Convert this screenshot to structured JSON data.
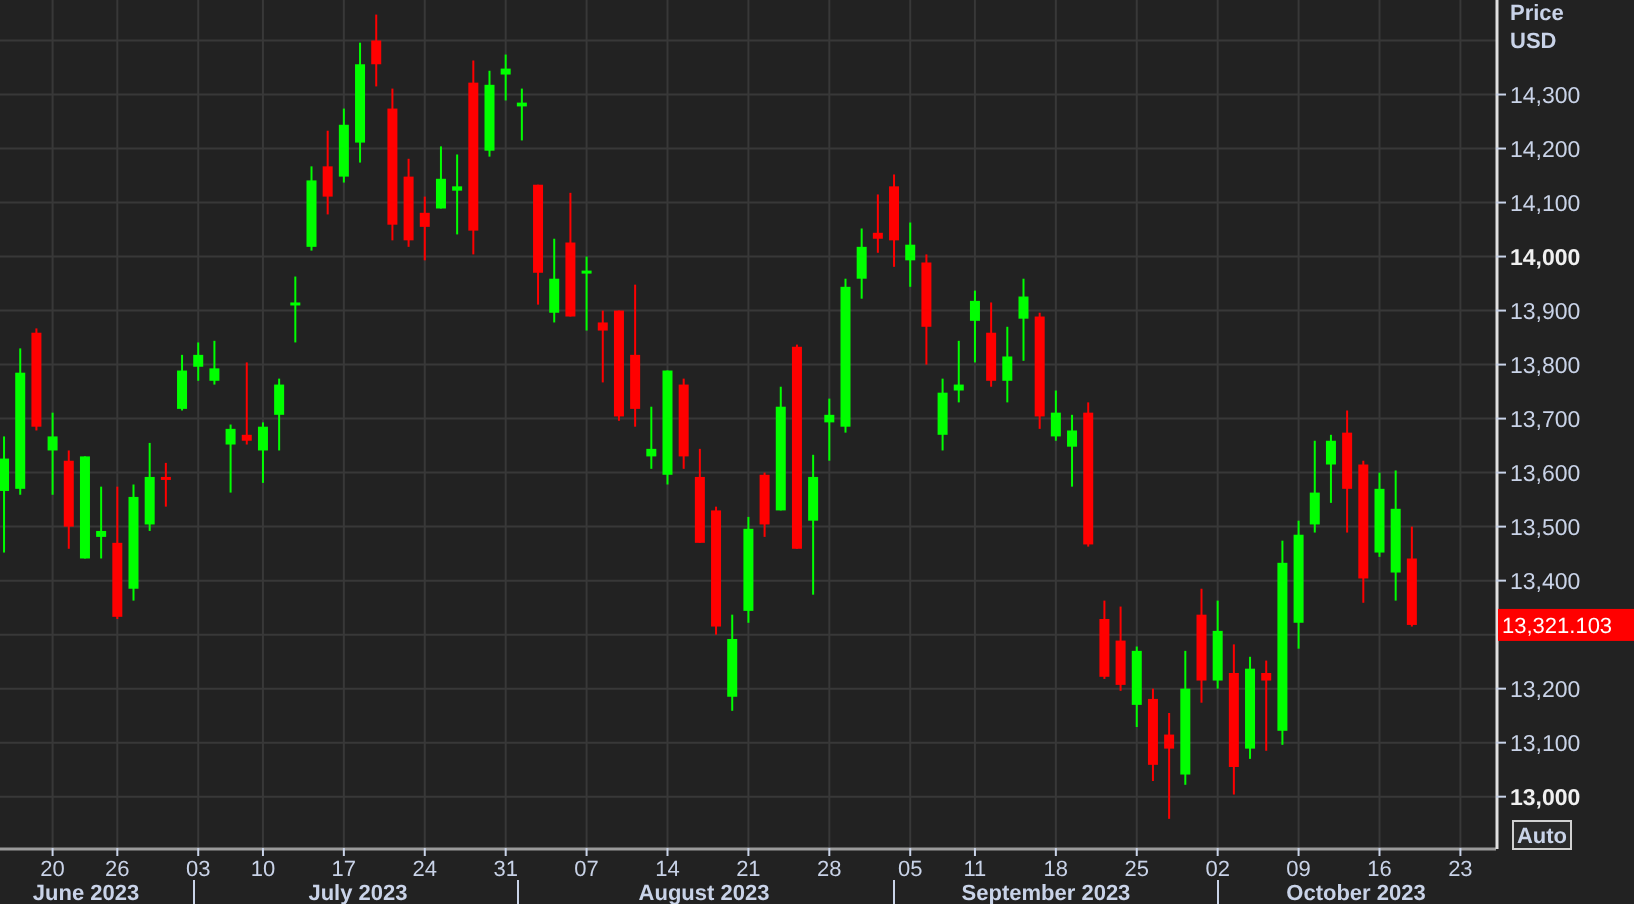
{
  "chart": {
    "axis_unit": "USD",
    "last_price": "13,321.103",
    "auto_button": "Auto",
    "month_labels": [
      "June 2023",
      "July 2023",
      "August 2023",
      "September 2023",
      "October 2023"
    ],
    "chart_data": {
      "type": "candlestick",
      "ylabel": "Price",
      "ylim": [
        12905,
        14475
      ],
      "grid": true,
      "yticks": [
        {
          "value": 13000,
          "label": "13,000"
        },
        {
          "value": 13100,
          "label": "13,100"
        },
        {
          "value": 13200,
          "label": "13,200"
        },
        {
          "value": 13400,
          "label": "13,400"
        },
        {
          "value": 13500,
          "label": "13,500"
        },
        {
          "value": 13600,
          "label": "13,600"
        },
        {
          "value": 13700,
          "label": "13,700"
        },
        {
          "value": 13800,
          "label": "13,800"
        },
        {
          "value": 13900,
          "label": "13,900"
        },
        {
          "value": 14000,
          "label": "14,000"
        },
        {
          "value": 14100,
          "label": "14,100"
        },
        {
          "value": 14200,
          "label": "14,200"
        },
        {
          "value": 14300,
          "label": "14,300"
        }
      ],
      "categories": [
        null,
        null,
        null,
        "20",
        null,
        null,
        null,
        "26",
        null,
        null,
        null,
        null,
        "03",
        null,
        null,
        null,
        "10",
        null,
        null,
        null,
        null,
        "17",
        null,
        null,
        null,
        null,
        "24",
        null,
        null,
        null,
        null,
        "31",
        null,
        null,
        null,
        null,
        "07",
        null,
        null,
        null,
        null,
        "14",
        null,
        null,
        null,
        null,
        "21",
        null,
        null,
        null,
        null,
        "28",
        null,
        null,
        null,
        null,
        "05",
        null,
        null,
        null,
        "11",
        null,
        null,
        null,
        null,
        "18",
        null,
        null,
        null,
        null,
        "25",
        null,
        null,
        null,
        null,
        "02",
        null,
        null,
        null,
        null,
        "09",
        null,
        null,
        null,
        null,
        "16",
        null,
        null,
        null,
        null,
        "23"
      ],
      "ohlc": [
        [
          13566,
          13667,
          13452,
          13626
        ],
        [
          13570,
          13830,
          13559,
          13785
        ],
        [
          13859,
          13867,
          13678,
          13685
        ],
        [
          13641,
          13711,
          13559,
          13667
        ],
        [
          13622,
          13641,
          13459,
          13500
        ],
        [
          13441,
          13630,
          13441,
          13630
        ],
        [
          13481,
          13574,
          13441,
          13492
        ],
        [
          13470,
          13574,
          13329,
          13333
        ],
        [
          13385,
          13578,
          13363,
          13555
        ],
        [
          13504,
          13655,
          13492,
          13592
        ],
        [
          13592,
          13618,
          13537,
          13589
        ],
        [
          13718,
          13818,
          13715,
          13789
        ],
        [
          13796,
          13841,
          13770,
          13818
        ],
        [
          13770,
          13844,
          13763,
          13793
        ],
        [
          13652,
          13689,
          13563,
          13681
        ],
        [
          13670,
          13804,
          13652,
          13659
        ],
        [
          13641,
          13693,
          13581,
          13685
        ],
        [
          13707,
          13774,
          13641,
          13763
        ],
        [
          13911,
          13963,
          13841,
          13915
        ],
        [
          14018,
          14167,
          14011,
          14141
        ],
        [
          14167,
          14233,
          14078,
          14111
        ],
        [
          14148,
          14274,
          14137,
          14244
        ],
        [
          14211,
          14396,
          14174,
          14356
        ],
        [
          14400,
          14448,
          14315,
          14356
        ],
        [
          14274,
          14311,
          14030,
          14059
        ],
        [
          14148,
          14181,
          14018,
          14030
        ],
        [
          14081,
          14111,
          13993,
          14055
        ],
        [
          14089,
          14204,
          14089,
          14144
        ],
        [
          14122,
          14189,
          14041,
          14130
        ],
        [
          14322,
          14363,
          14004,
          14048
        ],
        [
          14196,
          14344,
          14185,
          14318
        ],
        [
          14337,
          14374,
          14289,
          14348
        ],
        [
          14278,
          14311,
          14215,
          14285
        ],
        [
          14133,
          14133,
          13911,
          13970
        ],
        [
          13896,
          14033,
          13878,
          13959
        ],
        [
          14026,
          14118,
          13889,
          13889
        ],
        [
          13974,
          14000,
          13863,
          13974
        ],
        [
          13878,
          13900,
          13767,
          13863
        ],
        [
          13900,
          13900,
          13696,
          13704
        ],
        [
          13818,
          13948,
          13685,
          13718
        ],
        [
          13630,
          13722,
          13607,
          13644
        ],
        [
          13596,
          13789,
          13578,
          13789
        ],
        [
          13763,
          13774,
          13607,
          13630
        ],
        [
          13592,
          13644,
          13470,
          13470
        ],
        [
          13530,
          13537,
          13300,
          13315
        ],
        [
          13185,
          13337,
          13159,
          13292
        ],
        [
          13344,
          13518,
          13322,
          13496
        ],
        [
          13596,
          13600,
          13481,
          13504
        ],
        [
          13530,
          13759,
          13530,
          13722
        ],
        [
          13833,
          13837,
          13459,
          13459
        ],
        [
          13511,
          13633,
          13374,
          13592
        ],
        [
          13693,
          13737,
          13622,
          13707
        ],
        [
          13685,
          13959,
          13674,
          13944
        ],
        [
          13959,
          14052,
          13922,
          14018
        ],
        [
          14044,
          14115,
          14007,
          14033
        ],
        [
          14130,
          14152,
          13981,
          14030
        ],
        [
          13993,
          14063,
          13944,
          14022
        ],
        [
          13989,
          14004,
          13800,
          13870
        ],
        [
          13670,
          13774,
          13641,
          13748
        ],
        [
          13752,
          13844,
          13730,
          13763
        ],
        [
          13881,
          13937,
          13804,
          13918
        ],
        [
          13859,
          13915,
          13759,
          13770
        ],
        [
          13770,
          13870,
          13730,
          13815
        ],
        [
          13885,
          13959,
          13807,
          13926
        ],
        [
          13889,
          13896,
          13681,
          13704
        ],
        [
          13667,
          13752,
          13659,
          13711
        ],
        [
          13648,
          13707,
          13574,
          13678
        ],
        [
          13711,
          13730,
          13463,
          13467
        ],
        [
          13329,
          13363,
          13218,
          13222
        ],
        [
          13289,
          13352,
          13196,
          13207
        ],
        [
          13170,
          13278,
          13129,
          13270
        ],
        [
          13181,
          13200,
          13029,
          13059
        ],
        [
          13115,
          13155,
          12959,
          13089
        ],
        [
          13041,
          13270,
          13022,
          13200
        ],
        [
          13337,
          13385,
          13174,
          13215
        ],
        [
          13215,
          13363,
          13200,
          13307
        ],
        [
          13229,
          13282,
          13004,
          13055
        ],
        [
          13089,
          13259,
          13070,
          13237
        ],
        [
          13229,
          13252,
          13085,
          13215
        ],
        [
          13122,
          13474,
          13096,
          13433
        ],
        [
          13322,
          13511,
          13274,
          13485
        ],
        [
          13504,
          13659,
          13489,
          13563
        ],
        [
          13615,
          13670,
          13544,
          13659
        ],
        [
          13674,
          13715,
          13489,
          13570
        ],
        [
          13615,
          13622,
          13359,
          13404
        ],
        [
          13452,
          13600,
          13444,
          13570
        ],
        [
          13415,
          13604,
          13363,
          13533
        ],
        [
          13441,
          13500,
          13315,
          13318
        ],
        null,
        null,
        null
      ]
    }
  }
}
